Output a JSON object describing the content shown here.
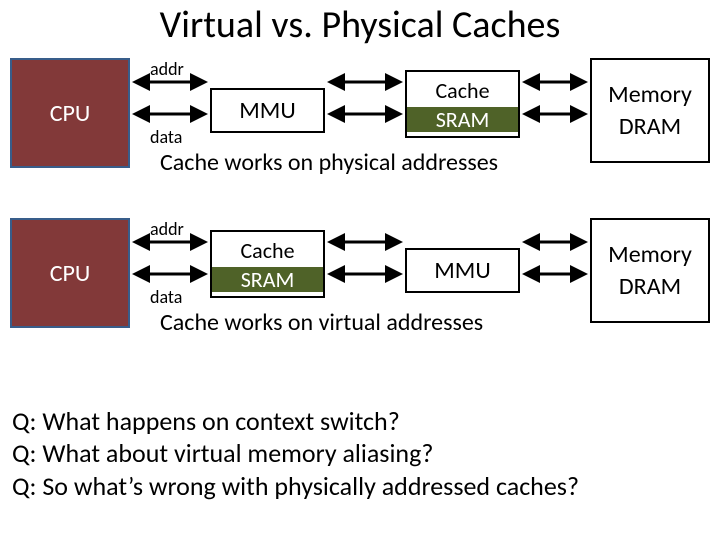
{
  "title": "Virtual vs. Physical Caches",
  "labels": {
    "cpu": "CPU",
    "mmu": "MMU",
    "cache": "Cache",
    "sram": "SRAM",
    "memory": "Memory",
    "dram": "DRAM",
    "addr": "addr",
    "data": "data"
  },
  "captions": {
    "physical": "Cache works on physical addresses",
    "virtual": "Cache works on virtual addresses"
  },
  "questions": {
    "q1": "Q: What happens on context switch?",
    "q2": "Q: What about virtual memory aliasing?",
    "q3": "Q: So what’s wrong with physically addressed caches?"
  }
}
